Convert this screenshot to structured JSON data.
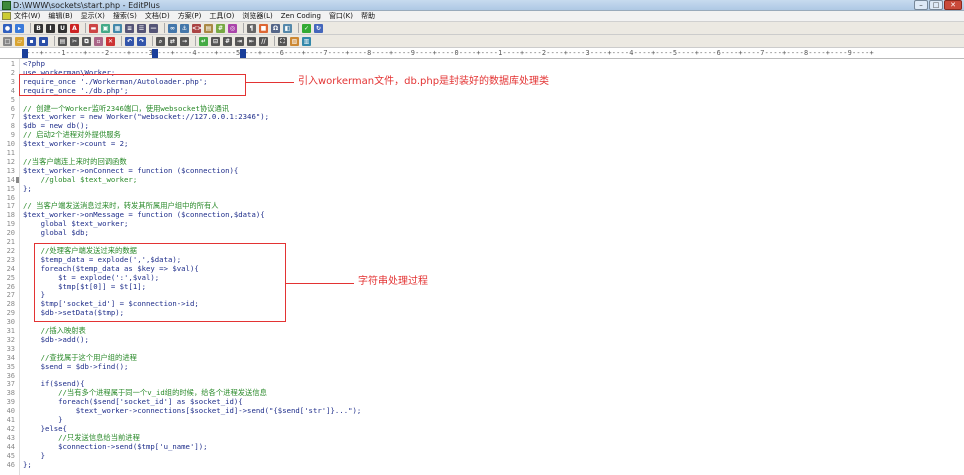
{
  "window": {
    "title": "D:\\WWW\\sockets\\start.php - EditPlus",
    "controls": {
      "minimize": "–",
      "maximize": "□",
      "close": "✕"
    }
  },
  "menu": {
    "items": [
      "文件(W)",
      "编辑(B)",
      "显示(X)",
      "搜索(S)",
      "文档(D)",
      "方案(P)",
      "工具(O)",
      "浏览器(L)",
      "Zen Coding",
      "窗口(K)",
      "帮助"
    ]
  },
  "toolbar": {
    "row1_icons": [
      {
        "name": "new-icon",
        "glyph": "●",
        "color": "#2f5fbf"
      },
      {
        "name": "open-icon",
        "glyph": "▸",
        "color": "#3a7ad9"
      },
      {
        "name": "bold-icon",
        "glyph": "B",
        "color": "#333"
      },
      {
        "name": "italic-icon",
        "glyph": "I",
        "color": "#333"
      },
      {
        "name": "underline-icon",
        "glyph": "U",
        "color": "#333"
      },
      {
        "name": "font-color-icon",
        "glyph": "A",
        "color": "#c22"
      },
      {
        "name": "highlight-icon",
        "glyph": "▬",
        "color": "#c44"
      },
      {
        "name": "image-icon",
        "glyph": "▣",
        "color": "#4a8"
      },
      {
        "name": "table-icon",
        "glyph": "▦",
        "color": "#48a"
      },
      {
        "name": "align-icon",
        "glyph": "≡",
        "color": "#557"
      },
      {
        "name": "list-icon",
        "glyph": "☰",
        "color": "#557"
      },
      {
        "name": "hr-icon",
        "glyph": "—",
        "color": "#557"
      },
      {
        "name": "link-icon",
        "glyph": "∞",
        "color": "#47a"
      },
      {
        "name": "anchor-icon",
        "glyph": "⚓",
        "color": "#47a"
      },
      {
        "name": "code-icon",
        "glyph": "<>",
        "color": "#a44"
      },
      {
        "name": "form-icon",
        "glyph": "▤",
        "color": "#a84"
      },
      {
        "name": "css-icon",
        "glyph": "#",
        "color": "#7a4"
      },
      {
        "name": "preview-icon",
        "glyph": "◎",
        "color": "#a4a"
      },
      {
        "name": "nbsp-icon",
        "glyph": "¶",
        "color": "#666"
      },
      {
        "name": "color-icon",
        "glyph": "■",
        "color": "#d63"
      },
      {
        "name": "chars-icon",
        "glyph": "Ω",
        "color": "#568"
      },
      {
        "name": "dir-icon",
        "glyph": "◧",
        "color": "#58a"
      },
      {
        "name": "check-icon",
        "glyph": "✓",
        "color": "#3a3"
      },
      {
        "name": "sync-icon",
        "glyph": "↻",
        "color": "#46b"
      }
    ],
    "row2_icons": [
      {
        "name": "file-new-icon",
        "glyph": "□",
        "color": "#888"
      },
      {
        "name": "file-open-icon",
        "glyph": "▱",
        "color": "#d9a431"
      },
      {
        "name": "save-icon",
        "glyph": "▪",
        "color": "#2b4fa8"
      },
      {
        "name": "save-all-icon",
        "glyph": "▪",
        "color": "#2b4fa8"
      },
      {
        "name": "print-icon",
        "glyph": "▤",
        "color": "#555"
      },
      {
        "name": "cut-icon",
        "glyph": "✂",
        "color": "#555"
      },
      {
        "name": "copy-icon",
        "glyph": "⧉",
        "color": "#555"
      },
      {
        "name": "paste-icon",
        "glyph": "▫",
        "color": "#a68"
      },
      {
        "name": "delete-icon",
        "glyph": "✕",
        "color": "#c33"
      },
      {
        "name": "undo-icon",
        "glyph": "↶",
        "color": "#35a"
      },
      {
        "name": "redo-icon",
        "glyph": "↷",
        "color": "#35a"
      },
      {
        "name": "find-icon",
        "glyph": "⌕",
        "color": "#555"
      },
      {
        "name": "replace-icon",
        "glyph": "⇄",
        "color": "#555"
      },
      {
        "name": "goto-icon",
        "glyph": "→",
        "color": "#555"
      },
      {
        "name": "wordwrap-icon",
        "glyph": "↵",
        "color": "#4a4"
      },
      {
        "name": "ruler-icon",
        "glyph": "⊟",
        "color": "#555"
      },
      {
        "name": "linenum-icon",
        "glyph": "#",
        "color": "#555"
      },
      {
        "name": "indent-icon",
        "glyph": "⇥",
        "color": "#555"
      },
      {
        "name": "outdent-icon",
        "glyph": "⇤",
        "color": "#555"
      },
      {
        "name": "comment-icon",
        "glyph": "//",
        "color": "#555"
      },
      {
        "name": "fullscreen-icon",
        "glyph": "⛶",
        "color": "#555"
      },
      {
        "name": "cliptext-icon",
        "glyph": "▧",
        "color": "#c83"
      },
      {
        "name": "dirwin-icon",
        "glyph": "▥",
        "color": "#38a"
      }
    ]
  },
  "ruler": {
    "text": "----+----1----+----2----+----3----+----4----+----5----+----6----+----7----+----8----+----9----+----0----+----1----+----2----+----3----+----4----+----5----+----6----+----7----+----8----+----9----+"
  },
  "editor": {
    "lines": [
      {
        "n": "1",
        "text": "<?php",
        "color": "#1e2d8a"
      },
      {
        "n": "2",
        "text": "use workerman\\Worker;",
        "color": "#1e2d8a"
      },
      {
        "n": "3",
        "text": "require_once './Workerman/Autoloader.php';",
        "color": "#1e2d8a"
      },
      {
        "n": "4",
        "text": "require_once './db.php';",
        "color": "#1e2d8a"
      },
      {
        "n": "5",
        "text": "",
        "color": "#1e2d8a"
      },
      {
        "n": "6",
        "text": "// 创建一个Worker监听2346端口，使用websocket协议通讯",
        "color": "#2a8a2a"
      },
      {
        "n": "7",
        "text": "$text_worker = new Worker(\"websocket://127.0.0.1:2346\");",
        "color": "#1e2d8a"
      },
      {
        "n": "8",
        "text": "$db = new db();",
        "color": "#1e2d8a"
      },
      {
        "n": "9",
        "text": "// 启动2个进程对外提供服务",
        "color": "#2a8a2a"
      },
      {
        "n": "10",
        "text": "$text_worker->count = 2;",
        "color": "#1e2d8a"
      },
      {
        "n": "11",
        "text": "",
        "color": "#1e2d8a"
      },
      {
        "n": "12",
        "text": "//当客户端连上来时的回调函数",
        "color": "#2a8a2a"
      },
      {
        "n": "13",
        "text": "$text_worker->onConnect = function ($connection){",
        "color": "#1e2d8a"
      },
      {
        "n": "14",
        "text": "    //global $text_worker;",
        "color": "#2a8a2a"
      },
      {
        "n": "15",
        "text": "};",
        "color": "#1e2d8a"
      },
      {
        "n": "16",
        "text": "",
        "color": "#1e2d8a"
      },
      {
        "n": "17",
        "text": "// 当客户端发送消息过来时，转发其所属用户组中的所有人",
        "color": "#2a8a2a"
      },
      {
        "n": "18",
        "text": "$text_worker->onMessage = function ($connection,$data){",
        "color": "#1e2d8a"
      },
      {
        "n": "19",
        "text": "    global $text_worker;",
        "color": "#1e2d8a"
      },
      {
        "n": "20",
        "text": "    global $db;",
        "color": "#1e2d8a"
      },
      {
        "n": "21",
        "text": "",
        "color": "#1e2d8a"
      },
      {
        "n": "22",
        "text": "    //处理客户端发送过来的数据",
        "color": "#2a8a2a"
      },
      {
        "n": "23",
        "text": "    $temp_data = explode(',',$data);",
        "color": "#1e2d8a"
      },
      {
        "n": "24",
        "text": "    foreach($temp_data as $key => $val){",
        "color": "#1e2d8a"
      },
      {
        "n": "25",
        "text": "        $t = explode(':',$val);",
        "color": "#1e2d8a"
      },
      {
        "n": "26",
        "text": "        $tmp[$t[0]] = $t[1];",
        "color": "#1e2d8a"
      },
      {
        "n": "27",
        "text": "    }",
        "color": "#1e2d8a"
      },
      {
        "n": "28",
        "text": "    $tmp['socket_id'] = $connection->id;",
        "color": "#1e2d8a"
      },
      {
        "n": "29",
        "text": "    $db->setData($tmp);",
        "color": "#1e2d8a"
      },
      {
        "n": "30",
        "text": "",
        "color": "#1e2d8a"
      },
      {
        "n": "31",
        "text": "    //插入映射表",
        "color": "#2a8a2a"
      },
      {
        "n": "32",
        "text": "    $db->add();",
        "color": "#1e2d8a"
      },
      {
        "n": "33",
        "text": "",
        "color": "#1e2d8a"
      },
      {
        "n": "34",
        "text": "    //查找属于这个用户组的进程",
        "color": "#2a8a2a"
      },
      {
        "n": "35",
        "text": "    $send = $db->find();",
        "color": "#1e2d8a"
      },
      {
        "n": "36",
        "text": "",
        "color": "#1e2d8a"
      },
      {
        "n": "37",
        "text": "    if($send){",
        "color": "#1e2d8a"
      },
      {
        "n": "38",
        "text": "        //当有多个进程属于同一个v_id组的时候，给各个进程发送信息",
        "color": "#2a8a2a"
      },
      {
        "n": "39",
        "text": "        foreach($send['socket_id'] as $socket_id){",
        "color": "#1e2d8a"
      },
      {
        "n": "40",
        "text": "            $text_worker->connections[$socket_id]->send(\"{$send['str']}...\");",
        "color": "#1e2d8a"
      },
      {
        "n": "41",
        "text": "        }",
        "color": "#1e2d8a"
      },
      {
        "n": "42",
        "text": "    }else{",
        "color": "#1e2d8a"
      },
      {
        "n": "43",
        "text": "        //只发送信息给当前进程",
        "color": "#2a8a2a"
      },
      {
        "n": "44",
        "text": "        $connection->send($tmp['u_name']);",
        "color": "#1e2d8a"
      },
      {
        "n": "45",
        "text": "    }",
        "color": "#1e2d8a"
      },
      {
        "n": "46",
        "text": "};",
        "color": "#1e2d8a"
      }
    ]
  },
  "annotations": {
    "top": "引入workerman文件，db.php是封装好的数据库处理类",
    "middle": "字符串处理过程",
    "color": "#e33333"
  }
}
